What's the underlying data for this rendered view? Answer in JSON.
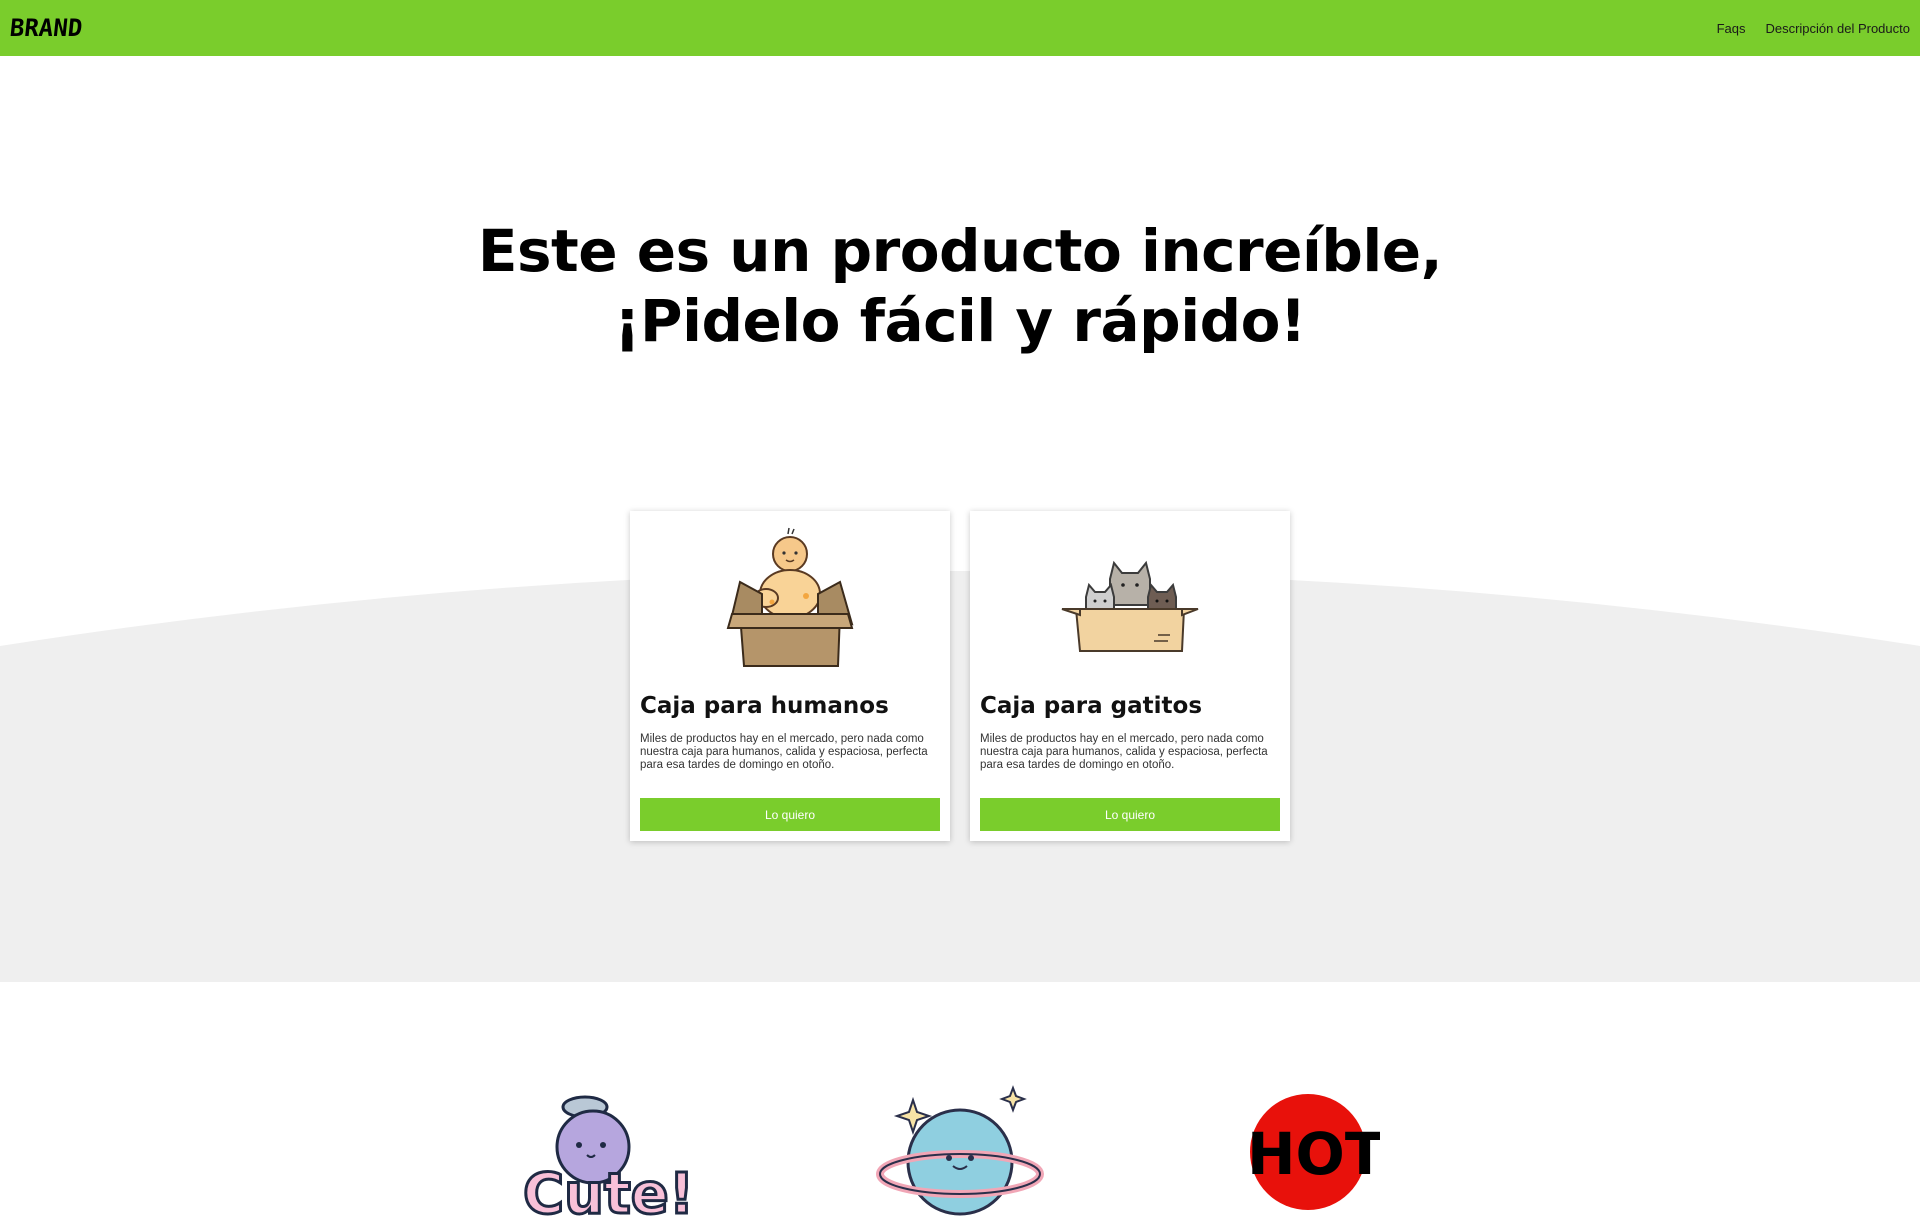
{
  "navbar": {
    "brand": "BRAND",
    "links": [
      "Faqs",
      "Descripción del Producto"
    ],
    "color": "#7acd2c"
  },
  "hero": {
    "title_line1": "Este es un producto increíble,",
    "title_line2": "¡Pidelo fácil y rápido!",
    "background_color": "#efefef"
  },
  "products": [
    {
      "title": "Caja para humanos",
      "description": "Miles de productos hay en el mercado, pero nada como nuestra caja para humanos, calida y espaciosa, perfecta para esa tardes de domingo en otoño.",
      "button": "Lo quiero",
      "image": "baby-in-box-illustration"
    },
    {
      "title": "Caja para gatitos",
      "description": "Miles de productos hay en el mercado, pero nada como nuestra caja para humanos, calida y espaciosa, perfecta para esa tardes de domingo en otoño.",
      "button": "Lo quiero",
      "image": "cats-in-box-illustration"
    }
  ],
  "stickers": {
    "items": [
      "cute-sticker",
      "planet-sticker",
      "hot-sticker"
    ],
    "cute_text": "Cute!",
    "hot_text": "HOT"
  }
}
